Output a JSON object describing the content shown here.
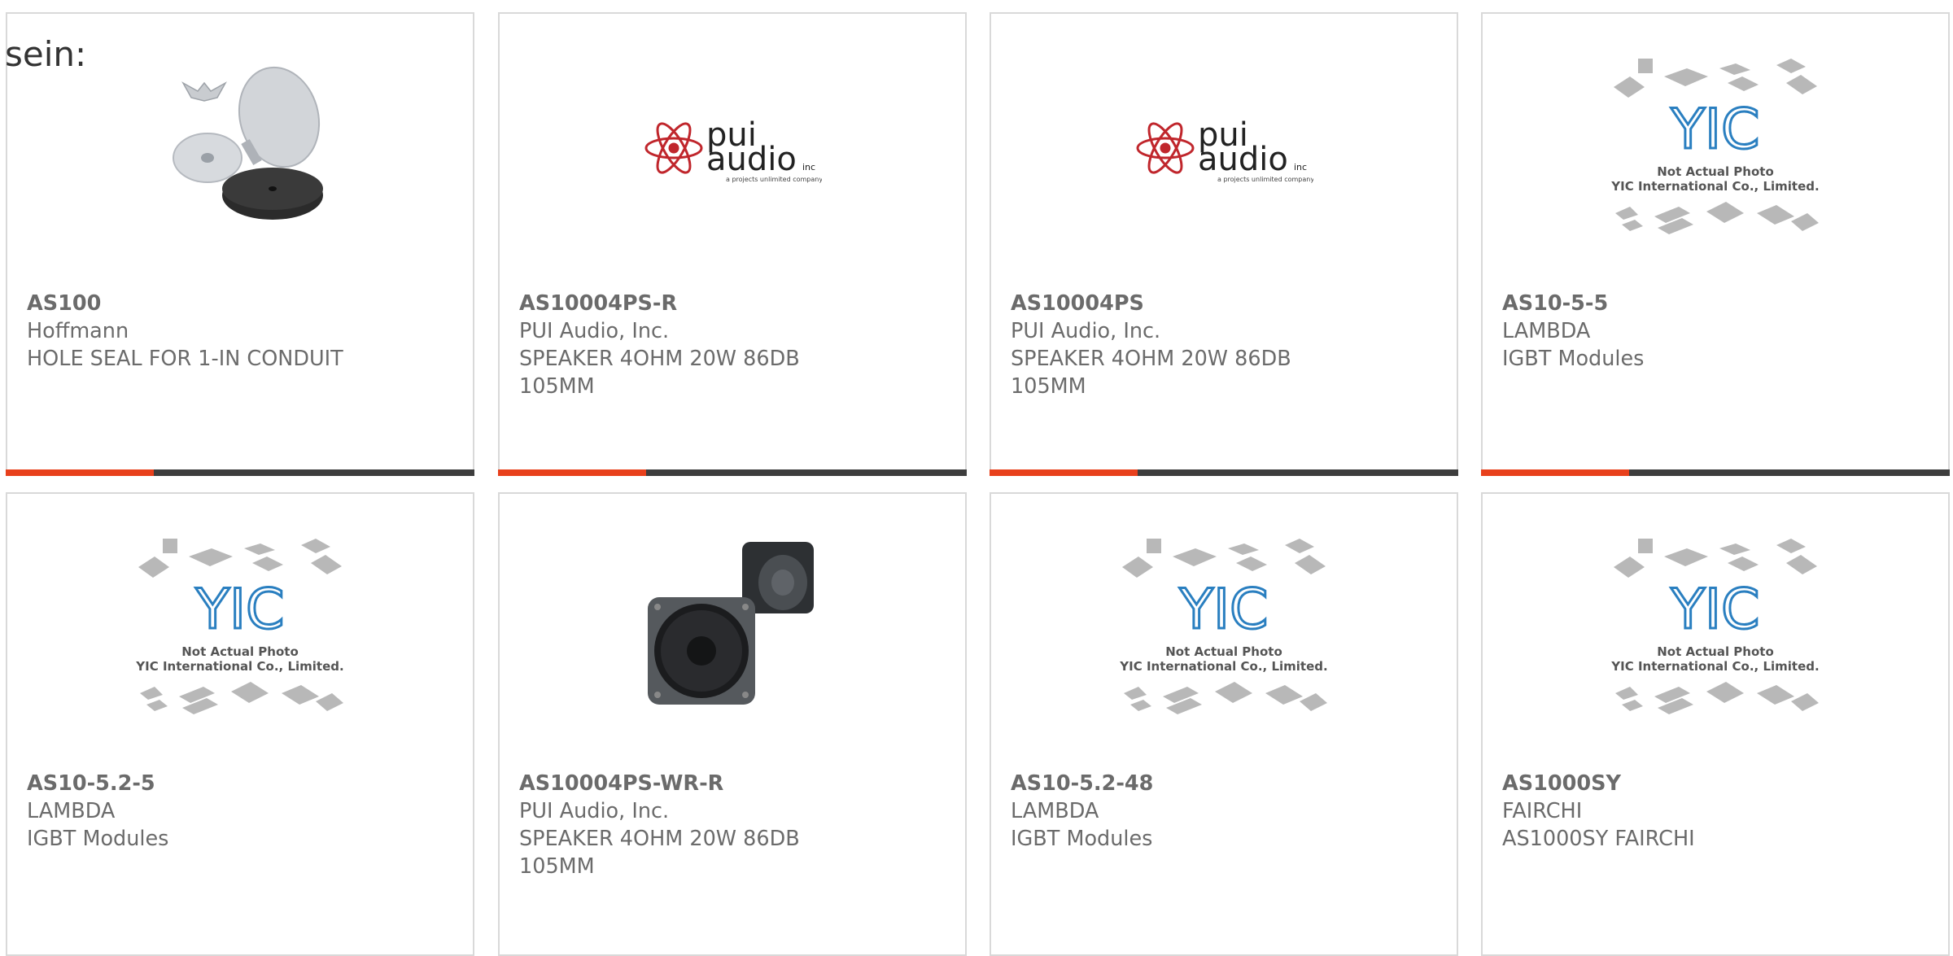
{
  "intro_text": "sein:",
  "colors": {
    "accent": "#e8401c",
    "bar": "#3d3d3d",
    "border": "#d9d9d9",
    "text": "#6b6b6b"
  },
  "products": [
    {
      "part_number": "AS100",
      "manufacturer": "Hoffmann",
      "description": "HOLE SEAL FOR 1-IN CONDUIT",
      "image": "hole-seal-photo"
    },
    {
      "part_number": "AS10004PS-R",
      "manufacturer": "PUI Audio, Inc.",
      "description": "SPEAKER 4OHM 20W 86DB 105MM",
      "image": "pui-audio-logo"
    },
    {
      "part_number": "AS10004PS",
      "manufacturer": "PUI Audio, Inc.",
      "description": "SPEAKER 4OHM 20W 86DB 105MM",
      "image": "pui-audio-logo"
    },
    {
      "part_number": "AS10-5-5",
      "manufacturer": "LAMBDA",
      "description": "IGBT Modules",
      "image": "yic-placeholder"
    },
    {
      "part_number": "AS10-5.2-5",
      "manufacturer": "LAMBDA",
      "description": "IGBT Modules",
      "image": "yic-placeholder"
    },
    {
      "part_number": "AS10004PS-WR-R",
      "manufacturer": "PUI Audio, Inc.",
      "description": "SPEAKER 4OHM 20W 86DB 105MM",
      "image": "speaker-photo"
    },
    {
      "part_number": "AS10-5.2-48",
      "manufacturer": "LAMBDA",
      "description": "IGBT Modules",
      "image": "yic-placeholder"
    },
    {
      "part_number": "AS1000SY",
      "manufacturer": "FAIRCHI",
      "description": "AS1000SY FAIRCHI",
      "image": "yic-placeholder"
    }
  ],
  "pui_logo": {
    "line1": "pui",
    "line2": "audio",
    "suffix": "inc",
    "tagline": "a projects unlimited company"
  },
  "yic_placeholder": {
    "logo": "YIC",
    "line1": "Not Actual Photo",
    "line2": "YIC International Co., Limited."
  }
}
